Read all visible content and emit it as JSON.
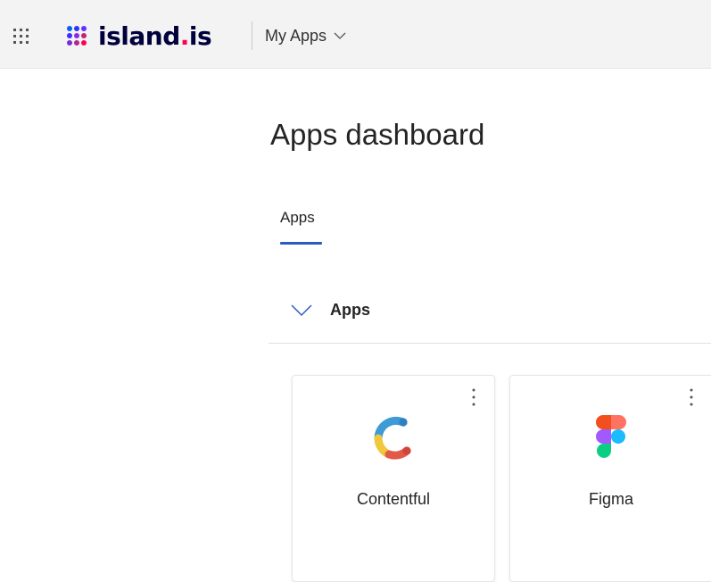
{
  "header": {
    "logo_text": "island",
    "logo_dot": ".",
    "logo_suffix": "is",
    "app_switcher_label": "My Apps",
    "waffle_icon": "app-launcher-icon",
    "colors": {
      "background": "#f3f3f3",
      "logo_text": "#00003c",
      "logo_dot": "#ff0050"
    }
  },
  "main": {
    "title": "Apps dashboard",
    "tabs": [
      {
        "label": "Apps",
        "active": true
      }
    ],
    "accent_color": "#2b5bbf",
    "sections": [
      {
        "label": "Apps",
        "expanded": true,
        "apps": [
          {
            "name": "Contentful",
            "icon": "contentful-logo-icon"
          },
          {
            "name": "Figma",
            "icon": "figma-logo-icon"
          }
        ]
      }
    ]
  }
}
